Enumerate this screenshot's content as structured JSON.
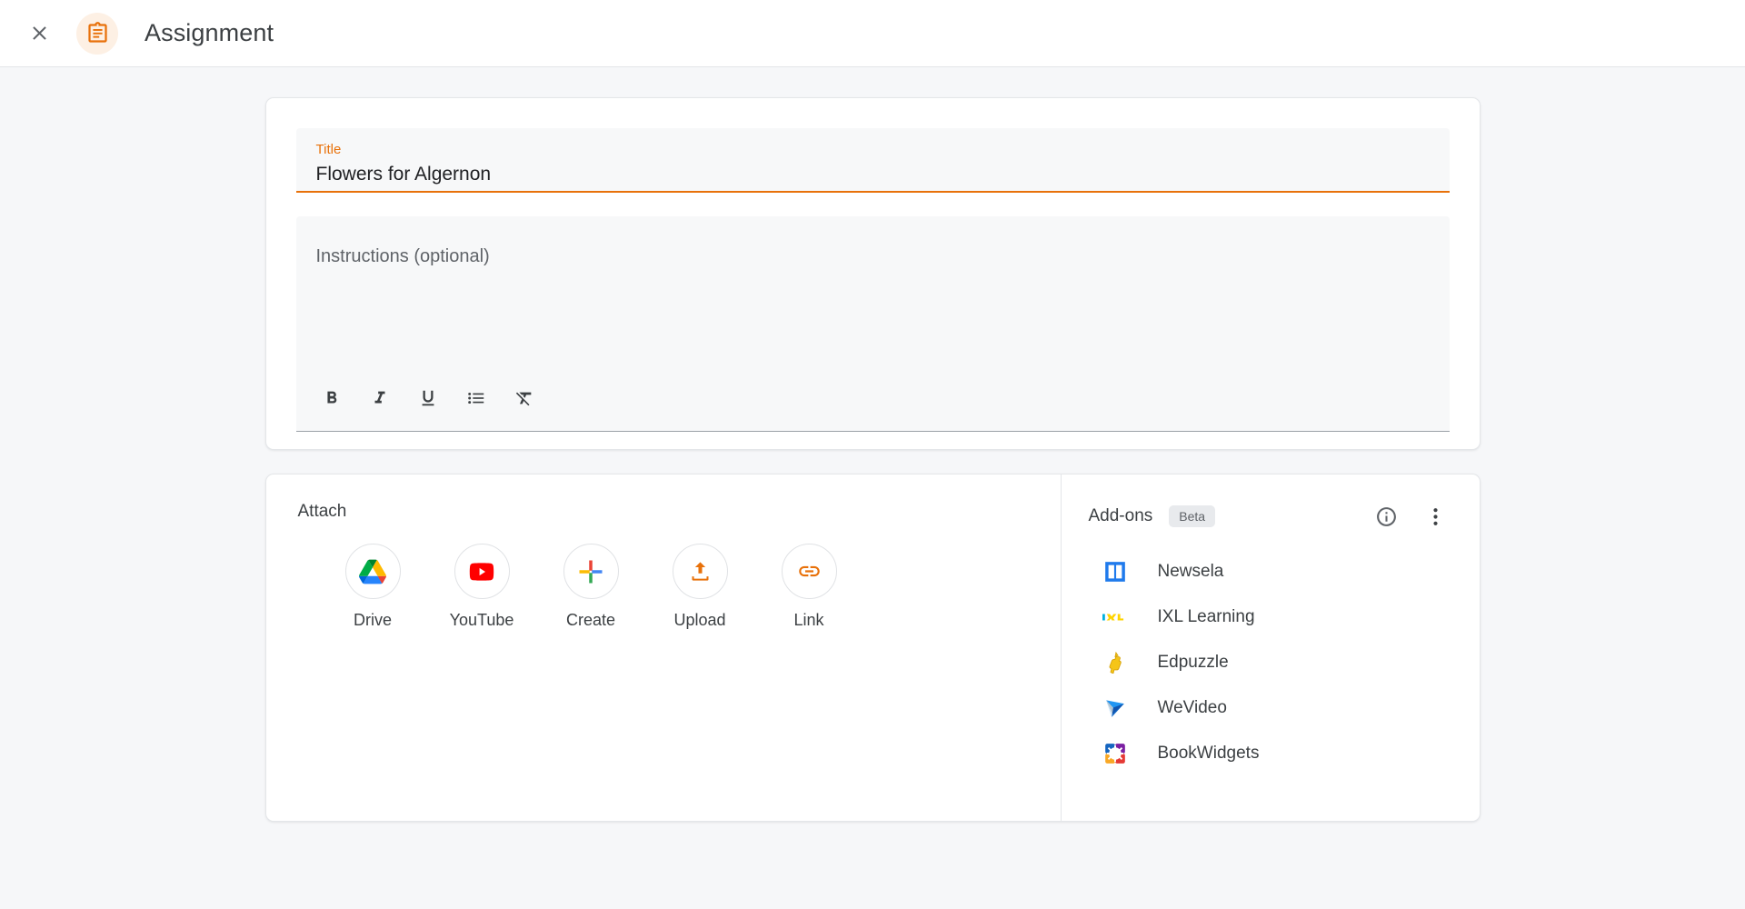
{
  "header": {
    "close_icon": "close-icon",
    "doc_icon": "assignment-clipboard-icon",
    "title": "Assignment"
  },
  "details": {
    "title_label": "Title",
    "title_value": "Flowers for Algernon",
    "instructions_placeholder": "Instructions (optional)",
    "toolbar": [
      {
        "name": "bold-icon",
        "label": "B"
      },
      {
        "name": "italic-icon",
        "label": "I"
      },
      {
        "name": "underline-icon",
        "label": "U"
      },
      {
        "name": "bulleted-list-icon",
        "label": ""
      },
      {
        "name": "clear-formatting-icon",
        "label": ""
      }
    ]
  },
  "attach": {
    "heading": "Attach",
    "items": [
      {
        "label": "Drive",
        "icon": "google-drive-icon"
      },
      {
        "label": "YouTube",
        "icon": "youtube-icon"
      },
      {
        "label": "Create",
        "icon": "create-plus-icon"
      },
      {
        "label": "Upload",
        "icon": "upload-icon"
      },
      {
        "label": "Link",
        "icon": "link-icon"
      }
    ]
  },
  "addons": {
    "title": "Add-ons",
    "badge": "Beta",
    "info_icon": "info-icon",
    "more_icon": "more-vertical-icon",
    "items": [
      {
        "label": "Newsela",
        "icon": "newsela-icon"
      },
      {
        "label": "IXL Learning",
        "icon": "ixl-learning-icon"
      },
      {
        "label": "Edpuzzle",
        "icon": "edpuzzle-icon"
      },
      {
        "label": "WeVideo",
        "icon": "wevideo-icon"
      },
      {
        "label": "BookWidgets",
        "icon": "bookwidgets-icon"
      }
    ]
  },
  "colors": {
    "accent_orange": "#e8710a",
    "page_background": "#f6f7f9",
    "text_primary": "#3c4043"
  }
}
